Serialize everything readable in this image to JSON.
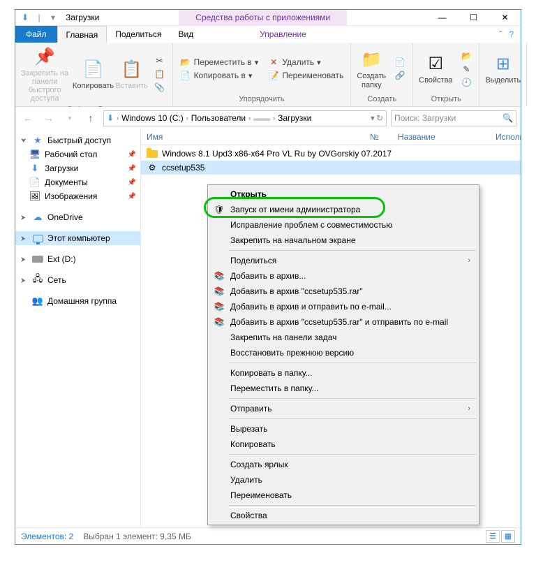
{
  "titlebar": {
    "title": "Загрузки",
    "tool_context": "Средства работы с приложениями"
  },
  "tabs": {
    "file": "Файл",
    "home": "Главная",
    "share": "Поделиться",
    "view": "Вид",
    "manage": "Управление"
  },
  "ribbon": {
    "pin": "Закрепить на панели быстрого доступа",
    "copy": "Копировать",
    "paste": "Вставить",
    "clipboard_label": "Буфер обмена",
    "move_to": "Переместить в",
    "copy_to": "Копировать в",
    "delete": "Удалить",
    "rename": "Переименовать",
    "organize_label": "Упорядочить",
    "new_folder": "Создать папку",
    "new_label": "Создать",
    "properties": "Свойства",
    "open_label": "Открыть",
    "select": "Выделить"
  },
  "path": {
    "root": "Windows 10 (C:)",
    "users": "Пользователи",
    "downloads_crumb": "Загрузки"
  },
  "search": {
    "placeholder": "Поиск: Загрузки"
  },
  "nav": {
    "quick": "Быстрый доступ",
    "desktop": "Рабочий стол",
    "downloads": "Загрузки",
    "documents": "Документы",
    "pictures": "Изображения",
    "onedrive": "OneDrive",
    "this_pc": "Этот компьютер",
    "ext": "Ext (D:)",
    "network": "Сеть",
    "homegroup": "Домашняя группа"
  },
  "columns": {
    "name": "Имя",
    "no": "№",
    "title_col": "Название",
    "artists": "Исполнит"
  },
  "files": [
    {
      "name": "Windows 8.1 Upd3 x86-x64 Pro VL Ru by OVGorskiy 07.2017",
      "type": "folder"
    },
    {
      "name": "ccsetup535",
      "type": "exe"
    }
  ],
  "ctx": {
    "open": "Открыть",
    "run_admin": "Запуск от имени администратора",
    "compat": "Исправление проблем с совместимостью",
    "pin_start": "Закрепить на начальном экране",
    "share": "Поделиться",
    "add_archive": "Добавить в архив...",
    "add_rar": "Добавить в архив \"ccsetup535.rar\"",
    "add_email": "Добавить в архив и отправить по e-mail...",
    "add_rar_email": "Добавить в архив \"ccsetup535.rar\" и отправить по e-mail",
    "pin_task": "Закрепить на панели задач",
    "restore": "Восстановить прежнюю версию",
    "copy_folder": "Копировать в папку...",
    "move_folder": "Переместить в папку...",
    "send_to": "Отправить",
    "cut": "Вырезать",
    "copy_c": "Копировать",
    "shortcut": "Создать ярлык",
    "delete_c": "Удалить",
    "rename_c": "Переименовать",
    "props": "Свойства"
  },
  "status": {
    "count": "Элементов: 2",
    "selected": "Выбран 1 элемент: 9,35 МБ"
  }
}
